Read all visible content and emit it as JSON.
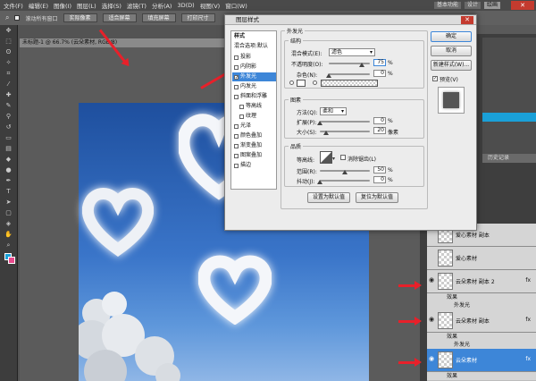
{
  "menu": [
    "文件(F)",
    "编辑(E)",
    "图像(I)",
    "图层(L)",
    "选择(S)",
    "滤镜(T)",
    "分析(A)",
    "3D(D)",
    "视图(V)",
    "窗口(W)"
  ],
  "workspace": {
    "basic": "基本功能",
    "design": "设计",
    "active": "绘画"
  },
  "options": {
    "all_windows": "滚动所有窗口",
    "btn1": "实际像素",
    "btn2": "适合屏幕",
    "btn3": "填充屏幕",
    "btn4": "打印尺寸"
  },
  "doc_tab": "未标题-1 @ 66.7% (云朵素材, RGB/8)",
  "hist_tab": "历史记录",
  "dialog": {
    "title": "图层样式",
    "styles_header": "样式",
    "blend_default": "混合选项:默认",
    "items": [
      "投影",
      "内阴影",
      "外发光",
      "内发光",
      "斜面和浮雕",
      "等高线",
      "纹理",
      "光泽",
      "颜色叠加",
      "渐变叠加",
      "图案叠加",
      "描边"
    ],
    "section_title": "外发光",
    "structure": {
      "title": "结构",
      "blend_mode_label": "混合模式(E):",
      "blend_mode_value": "滤色",
      "opacity_label": "不透明度(O):",
      "opacity_value": "75",
      "noise_label": "杂色(N):",
      "noise_value": "0",
      "pct": "%"
    },
    "elements": {
      "title": "图素",
      "technique_label": "方法(Q):",
      "technique_value": "柔和",
      "spread_label": "扩展(P):",
      "spread_value": "0",
      "size_label": "大小(S):",
      "size_value": "20",
      "px": "像素"
    },
    "quality": {
      "title": "品质",
      "contour_label": "等高线:",
      "antialias_label": "消除锯齿(L)",
      "range_label": "范围(R):",
      "range_value": "50",
      "jitter_label": "抖动(J):",
      "jitter_value": "0"
    },
    "btn_default": "设置为默认值",
    "btn_reset": "复位为默认值",
    "ok": "确定",
    "cancel": "取消",
    "new_style": "新建样式(W)...",
    "preview": "预览(V)"
  },
  "layers": [
    {
      "name": "爱心素材 副本",
      "fx": false,
      "visible": false
    },
    {
      "name": "爱心素材",
      "fx": false,
      "visible": false
    },
    {
      "name": "云朵素材 副本 2",
      "fx": true,
      "visible": true
    },
    {
      "name": "云朵素材 副本",
      "fx": true,
      "visible": true
    },
    {
      "name": "云朵素材",
      "fx": true,
      "visible": true,
      "selected": true
    }
  ],
  "effects_label": "效果",
  "outer_glow_label": "外发光",
  "colors": {
    "accent": "#3d86d8",
    "arrow": "#e8202a",
    "sky_top": "#1e4f9e",
    "sky_bottom": "#8fb6e6"
  }
}
